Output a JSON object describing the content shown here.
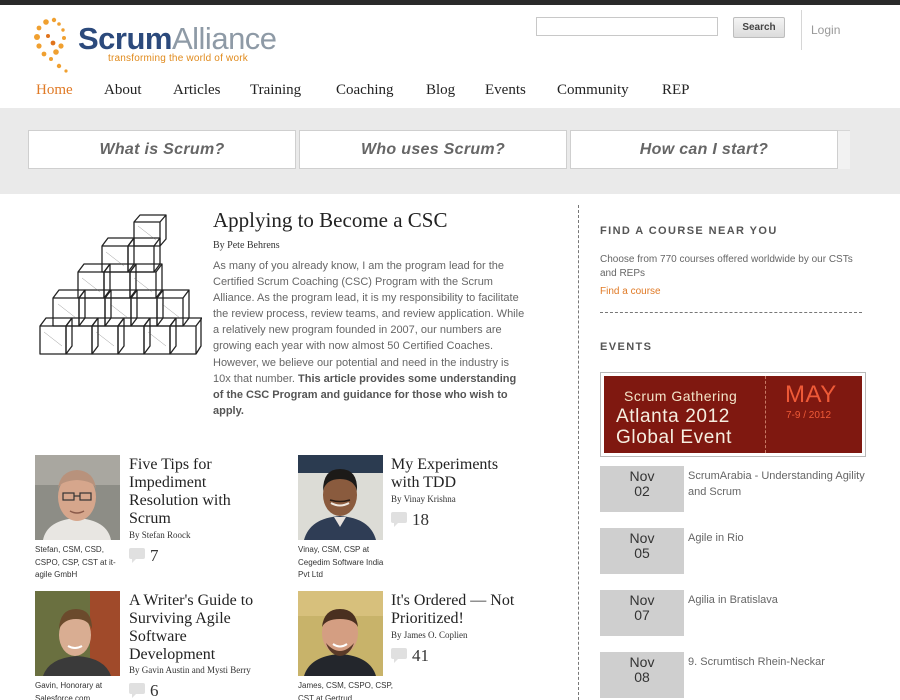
{
  "header": {
    "logo_scrum": "Scrum",
    "logo_alliance": "Alliance",
    "logo_tagline": "transforming the world of work",
    "search_button": "Search",
    "login": "Login"
  },
  "nav": {
    "items": [
      "Home",
      "About",
      "Articles",
      "Training",
      "Coaching",
      "Blog",
      "Events",
      "Community",
      "REP"
    ],
    "active_color": "#e07a26"
  },
  "quick_links": [
    "What is Scrum?",
    "Who uses Scrum?",
    "How can I start?"
  ],
  "feature": {
    "title": "Applying to Become a CSC",
    "byline": "By Pete Behrens",
    "body": "As many of you already know, I am the program lead for the Certified Scrum Coaching (CSC) Program with the Scrum Alliance. As the program lead, it is my responsibility to facilitate the review process, review teams, and review application. While a relatively new program founded in 2007, our numbers are growing each year with now almost 50 Certified Coaches. However, we believe our potential and need in the industry is 10x that number.",
    "body_bold": "This article provides some understanding of the CSC Program and guidance for those who wish to apply."
  },
  "articles": [
    {
      "title": "Five Tips for Impediment Resolution with Scrum",
      "byline": "By Stefan Roock",
      "comments": "7",
      "caption": "Stefan, CSM, CSD, CSPO, CSP, CST at it-agile GmbH"
    },
    {
      "title": "My Experiments with TDD",
      "byline": "By Vinay Krishna",
      "comments": "18",
      "caption": "Vinay, CSM, CSP at Cegedim Software India Pvt Ltd"
    },
    {
      "title": "A Writer's Guide to Surviving Agile Software Development",
      "byline": "By Gavin Austin and Mysti Berry",
      "comments": "6",
      "caption": "Gavin, Honorary at Salesforce.com"
    },
    {
      "title": "It's Ordered — Not Prioritized!",
      "byline": "By James O. Coplien",
      "comments": "41",
      "caption": "James, CSM, CSPO, CSP, CST at Gertrud"
    }
  ],
  "sidebar": {
    "course_heading": "FIND A COURSE NEAR YOU",
    "course_text": "Choose from 770 courses offered worldwide by our CSTs and REPs",
    "course_link": "Find a course",
    "events_heading": "EVENTS",
    "banner": {
      "line1": "Scrum Gathering",
      "line2": "Atlanta 2012",
      "line3": "Global Event",
      "month": "MAY",
      "dates": "7-9 / 2012"
    },
    "events": [
      {
        "month": "Nov",
        "day": "02",
        "name": "ScrumArabia - Understanding Agility and Scrum"
      },
      {
        "month": "Nov",
        "day": "05",
        "name": "Agile in Rio"
      },
      {
        "month": "Nov",
        "day": "07",
        "name": "Agilia in Bratislava"
      },
      {
        "month": "Nov",
        "day": "08",
        "name": "9. Scrumtisch Rhein-Neckar"
      }
    ]
  }
}
